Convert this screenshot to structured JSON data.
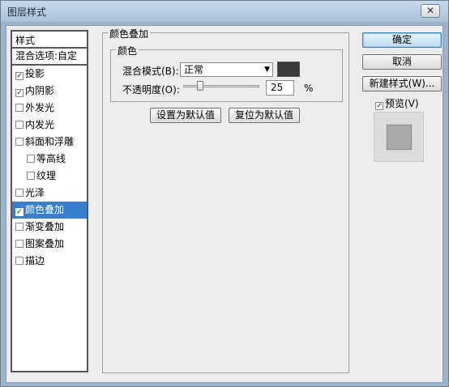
{
  "window": {
    "title": "图层样式",
    "close_glyph": "✕"
  },
  "sidebar": {
    "header": "样式",
    "blend_options": "混合选项:自定",
    "items": [
      {
        "label": "投影",
        "checked": true,
        "sub": false
      },
      {
        "label": "内阴影",
        "checked": true,
        "sub": false
      },
      {
        "label": "外发光",
        "checked": false,
        "sub": false
      },
      {
        "label": "内发光",
        "checked": false,
        "sub": false
      },
      {
        "label": "斜面和浮雕",
        "checked": false,
        "sub": false
      },
      {
        "label": "等高线",
        "checked": false,
        "sub": true
      },
      {
        "label": "纹理",
        "checked": false,
        "sub": true
      },
      {
        "label": "光泽",
        "checked": false,
        "sub": false
      },
      {
        "label": "颜色叠加",
        "checked": true,
        "sub": false,
        "selected": true
      },
      {
        "label": "渐变叠加",
        "checked": false,
        "sub": false
      },
      {
        "label": "图案叠加",
        "checked": false,
        "sub": false
      },
      {
        "label": "描边",
        "checked": false,
        "sub": false
      }
    ]
  },
  "panel": {
    "title": "颜色叠加",
    "color_group": "颜色",
    "blend_mode_label": "混合模式(B):",
    "blend_mode_value": "正常",
    "overlay_color": "#3a3a3a",
    "opacity_label": "不透明度(O):",
    "opacity_value": "25",
    "opacity_unit": "%",
    "set_default": "设置为默认值",
    "reset_default": "复位为默认值"
  },
  "actions": {
    "ok": "确定",
    "cancel": "取消",
    "new_style": "新建样式(W)...",
    "preview_label": "预览(V)",
    "preview_checked": true
  },
  "icons": {
    "check": "✓",
    "dropdown": "▼"
  }
}
